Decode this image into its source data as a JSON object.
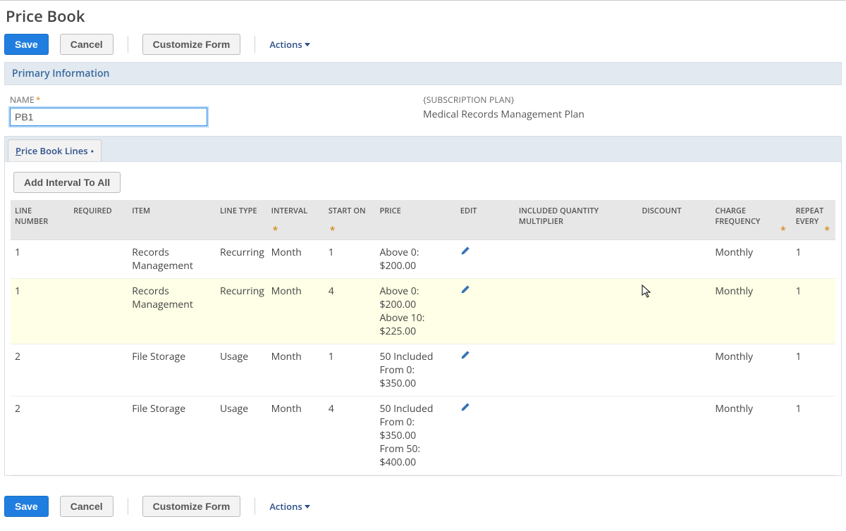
{
  "page": {
    "title": "Price Book"
  },
  "toolbar": {
    "save": "Save",
    "cancel": "Cancel",
    "customize": "Customize Form",
    "actions": "Actions"
  },
  "sections": {
    "primary_info": "Primary Information"
  },
  "fields": {
    "name_label": "NAME",
    "name_value": "PB1",
    "subscription_label": "{SUBSCRIPTION PLAN}",
    "subscription_value": "Medical Records Management Plan"
  },
  "tabs": {
    "price_book_lines": "rice Book Lines",
    "price_book_lines_prefix": "P"
  },
  "lines_toolbar": {
    "add_interval": "Add Interval To All"
  },
  "grid": {
    "headers": {
      "line_number": "LINE NUMBER",
      "required": "REQUIRED",
      "item": "ITEM",
      "line_type": "LINE TYPE",
      "interval": "INTERVAL",
      "start_on": "START ON",
      "price": "PRICE",
      "edit": "EDIT",
      "included_qty_mult": "INCLUDED QUANTITY MULTIPLIER",
      "discount": "DISCOUNT",
      "charge_frequency": "CHARGE FREQUENCY",
      "repeat_every": "REPEAT EVERY"
    },
    "rows": [
      {
        "line_number": "1",
        "required": "",
        "item": "Records Management",
        "line_type": "Recurring",
        "interval": "Month",
        "start_on": "1",
        "price": "Above 0: $200.00",
        "incl": "",
        "discount": "",
        "charge_frequency": "Monthly",
        "repeat_every": "1",
        "highlight": false
      },
      {
        "line_number": "1",
        "required": "",
        "item": "Records Management",
        "line_type": "Recurring",
        "interval": "Month",
        "start_on": "4",
        "price": "Above 0: $200.00\nAbove 10: $225.00",
        "incl": "",
        "discount": "",
        "charge_frequency": "Monthly",
        "repeat_every": "1",
        "highlight": true
      },
      {
        "line_number": "2",
        "required": "",
        "item": "File Storage",
        "line_type": "Usage",
        "interval": "Month",
        "start_on": "1",
        "price": "50 Included\nFrom 0: $350.00",
        "incl": "",
        "discount": "",
        "charge_frequency": "Monthly",
        "repeat_every": "1",
        "highlight": false
      },
      {
        "line_number": "2",
        "required": "",
        "item": "File Storage",
        "line_type": "Usage",
        "interval": "Month",
        "start_on": "4",
        "price": "50 Included\nFrom 0: $350.00\nFrom 50: $400.00",
        "incl": "",
        "discount": "",
        "charge_frequency": "Monthly",
        "repeat_every": "1",
        "highlight": false
      }
    ]
  }
}
